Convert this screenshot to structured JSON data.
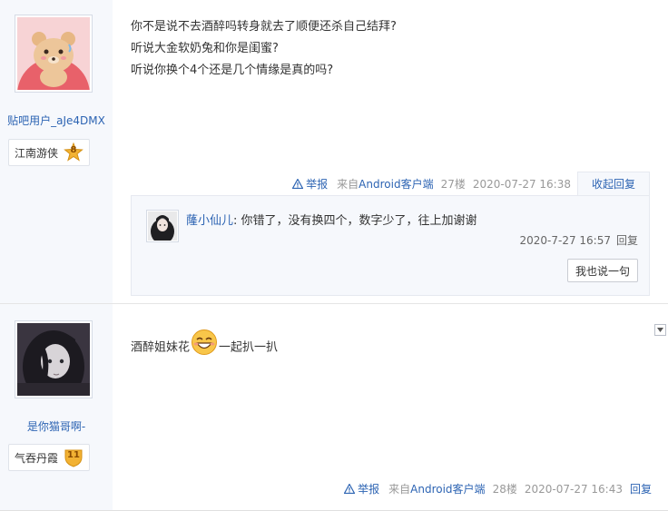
{
  "post1": {
    "username": "贴吧用户_aJe4DMX",
    "level_name": "江南游侠",
    "level_num": "8",
    "lines": [
      "你不是说不去酒醉吗转身就去了顺便还杀自己结拜?",
      "听说大金软奶兔和你是闺蜜?",
      "听说你换个4个还是几个情缘是真的吗?"
    ],
    "tail": {
      "report": "举报",
      "from_prefix": "来自",
      "from_client": "Android客户端",
      "floor": "27楼",
      "time": "2020-07-27 16:38",
      "collapse": "收起回复"
    },
    "sub_reply": {
      "user": "蕯小仙儿",
      "text": ": 你错了，没有换四个，数字少了，往上加谢谢",
      "time": "2020-7-27 16:57",
      "reply": "回复",
      "say_button": "我也说一句"
    }
  },
  "post2": {
    "username": "是你猫哥啊-",
    "level_name": "气吞丹霞",
    "level_num": "11",
    "text_before": "酒醉姐妹花",
    "text_after": "一起扒一扒",
    "tail": {
      "report": "举报",
      "from_prefix": "来自",
      "from_client": "Android客户端",
      "floor": "28楼",
      "time": "2020-07-27 16:43",
      "reply": "回复"
    }
  },
  "icons": {
    "report": "warning-triangle-icon",
    "dropdown": "chevron-down-icon",
    "emoji": "smile-emoji-icon"
  },
  "colors": {
    "link": "#2d64b3",
    "sidebar": "#f6f8fc",
    "badge_gold": "#f2b233"
  }
}
